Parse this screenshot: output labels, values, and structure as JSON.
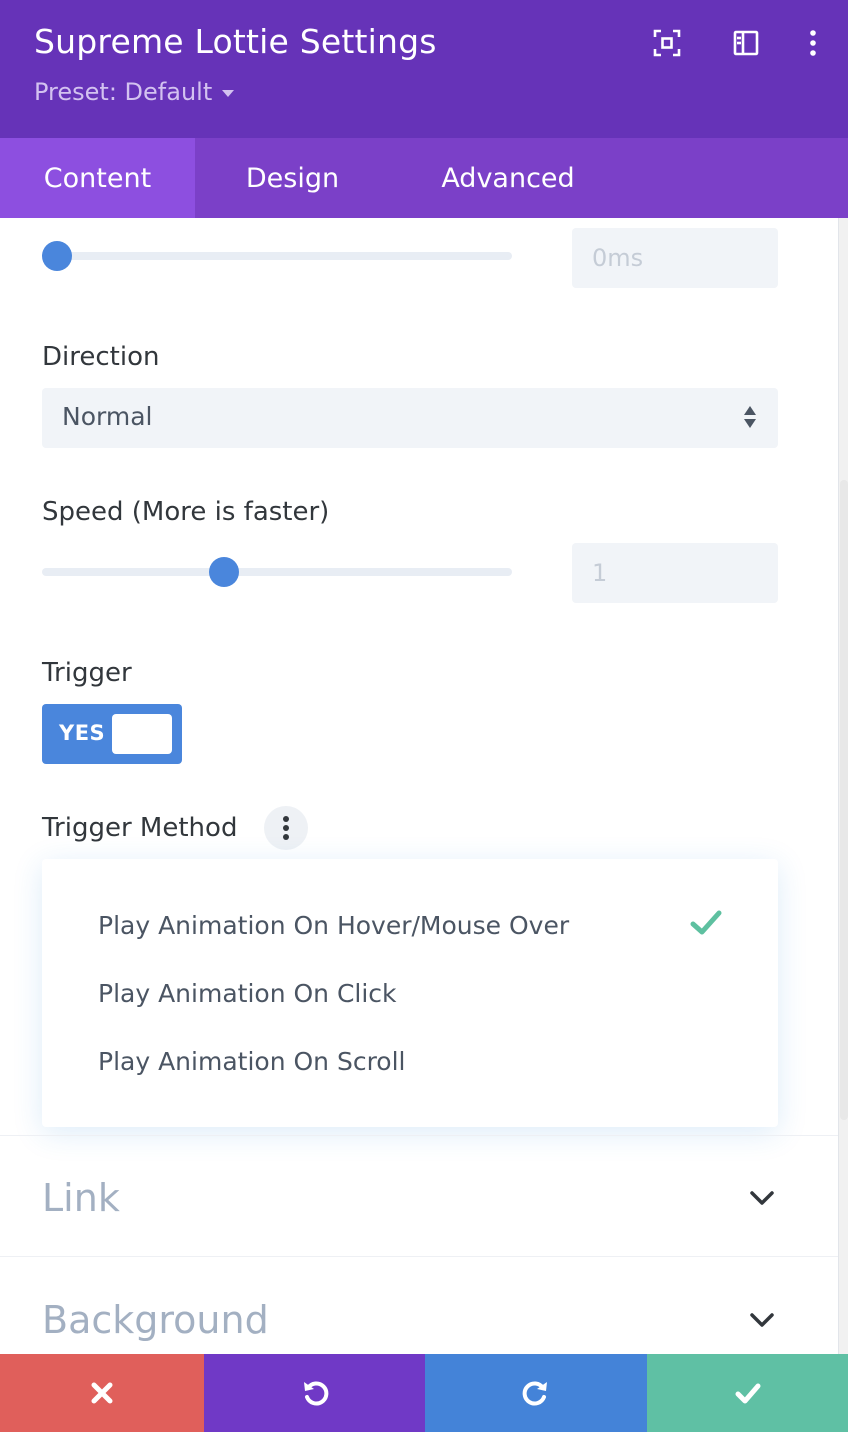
{
  "header": {
    "title": "Supreme Lottie Settings",
    "preset": "Preset: Default",
    "icons": [
      "focus-mode-icon",
      "sidebar-layout-icon",
      "more-options-icon"
    ],
    "background": "#6633b8"
  },
  "tabs": [
    {
      "label": "Content",
      "active": true
    },
    {
      "label": "Design",
      "active": false
    },
    {
      "label": "Advanced",
      "active": false
    }
  ],
  "delay": {
    "value": "0ms",
    "slider_fraction": 0
  },
  "direction": {
    "label": "Direction",
    "value": "Normal"
  },
  "speed": {
    "label": "Speed (More is faster)",
    "value": "1",
    "slider_fraction": 0.38
  },
  "trigger": {
    "label": "Trigger",
    "toggle_text": "YES",
    "enabled": true
  },
  "trigger_method": {
    "label": "Trigger Method",
    "options": [
      {
        "label": "Play Animation On Hover/Mouse Over",
        "selected": true
      },
      {
        "label": "Play Animation On Click",
        "selected": false
      },
      {
        "label": "Play Animation On Scroll",
        "selected": false
      }
    ]
  },
  "sections": [
    {
      "title": "Link"
    },
    {
      "title": "Background"
    }
  ],
  "footer": {
    "buttons": [
      {
        "name": "discard",
        "icon": "close-icon",
        "color": "#e05f5b"
      },
      {
        "name": "undo",
        "icon": "undo-icon",
        "color": "#7039c6"
      },
      {
        "name": "redo",
        "icon": "redo-icon",
        "color": "#4483d8"
      },
      {
        "name": "save",
        "icon": "check-icon",
        "color": "#5fc0a4"
      }
    ]
  },
  "colors": {
    "accent": "#4a86dc",
    "tab_bar": "#7b40c8",
    "active_tab": "#8d4fe0",
    "check": "#5ec0a0"
  }
}
